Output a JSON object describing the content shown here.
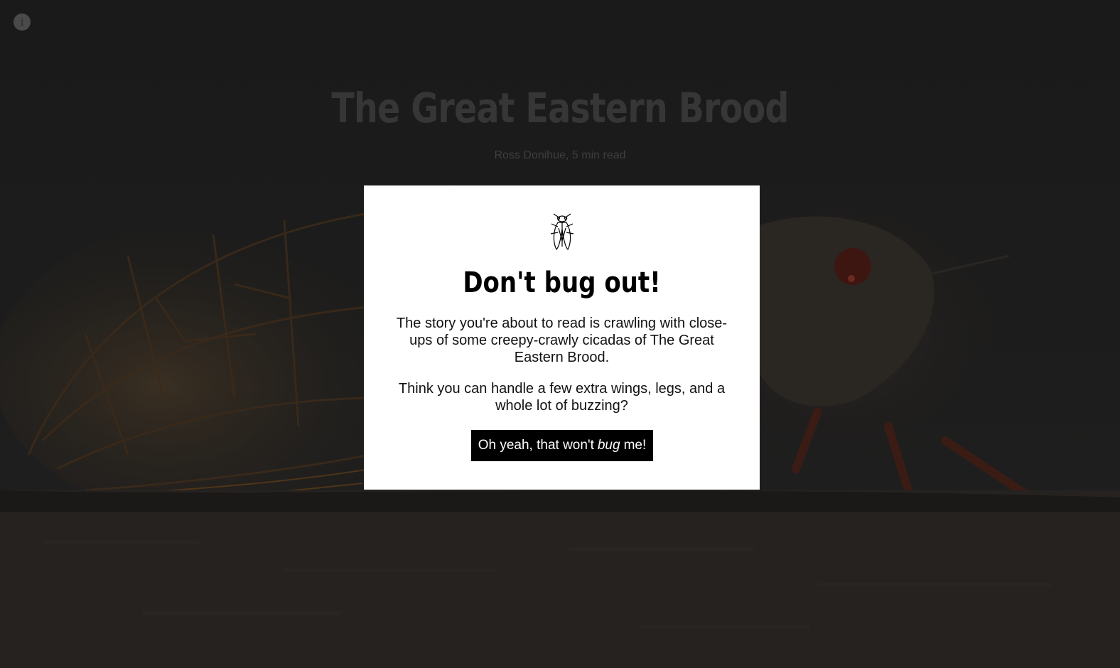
{
  "article": {
    "title": "The Great Eastern Brood",
    "byline": "Ross Donihue, 5 min read"
  },
  "info_button": {
    "glyph": "i"
  },
  "modal": {
    "icon": "cicada-icon",
    "title": "Don't bug out!",
    "paragraph1": "The story you're about to read is crawling with close-ups of some creepy-crawly cicadas of The Great Eastern Brood.",
    "paragraph2": "Think you can handle a few extra wings, legs, and a whole lot of buzzing?",
    "button": {
      "before": "Oh yeah, that won't",
      "emphasis": "bug",
      "after": "me!"
    }
  }
}
